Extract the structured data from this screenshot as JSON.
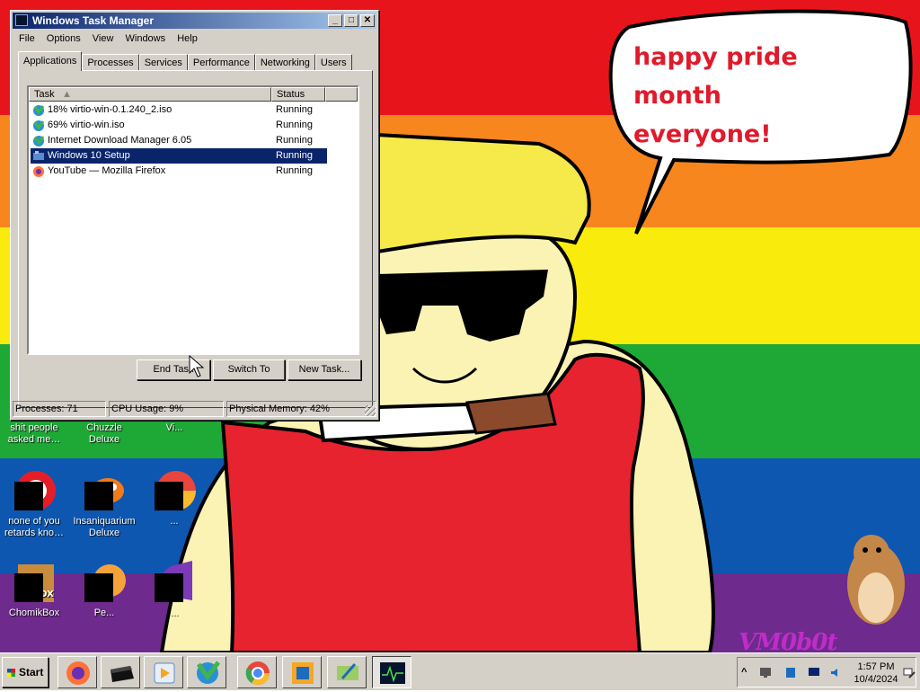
{
  "wallpaper": {
    "speech_bubble": [
      "happy pride month",
      "everyone!"
    ],
    "watermark": "VM0b0t"
  },
  "desktop_icons": [
    {
      "label": "shit people asked me…",
      "icon": "document-icon"
    },
    {
      "label": "Chuzzle Deluxe",
      "icon": "chuzzle-icon"
    },
    {
      "label": "Vi...",
      "icon": "shortcut-icon"
    },
    {
      "label": "none of you retards kno…",
      "icon": "opera-icon"
    },
    {
      "label": "Insaniquarium Deluxe",
      "icon": "insaniquarium-icon"
    },
    {
      "label": "...",
      "icon": "chrome-icon"
    },
    {
      "label": "ChomikBox",
      "icon": "chomikbox-icon"
    },
    {
      "label": "Pe...",
      "icon": "peggle-icon"
    },
    {
      "label": "...",
      "icon": "visual-studio-icon"
    }
  ],
  "task_manager": {
    "title": "Windows Task Manager",
    "window_buttons": [
      "_",
      "□",
      "✕"
    ],
    "menu": [
      "File",
      "Options",
      "View",
      "Windows",
      "Help"
    ],
    "tabs": [
      "Applications",
      "Processes",
      "Services",
      "Performance",
      "Networking",
      "Users"
    ],
    "active_tab": "Applications",
    "columns": [
      "Task",
      "Status"
    ],
    "rows": [
      {
        "task": "18% virtio-win-0.1.240_2.iso",
        "status": "Running",
        "icon": "idm-download-icon"
      },
      {
        "task": "69% virtio-win.iso",
        "status": "Running",
        "icon": "idm-download-icon"
      },
      {
        "task": "Internet Download Manager 6.05",
        "status": "Running",
        "icon": "idm-icon"
      },
      {
        "task": "Windows 10 Setup",
        "status": "Running",
        "icon": "setup-icon",
        "selected": true
      },
      {
        "task": "YouTube — Mozilla Firefox",
        "status": "Running",
        "icon": "firefox-icon"
      }
    ],
    "buttons": {
      "end_task": "End Task",
      "switch_to": "Switch To",
      "new_task": "New Task..."
    },
    "status": {
      "processes": "Processes: 71",
      "cpu": "CPU Usage: 9%",
      "memory": "Physical Memory: 42%"
    }
  },
  "taskbar": {
    "start_label": "Start",
    "apps": [
      "firefox-icon",
      "game-console-icon",
      "media-player-icon",
      "idm-icon",
      "chrome-icon",
      "virtualbox-icon",
      "network-paint-icon",
      "task-manager-icon"
    ],
    "clock_time": "1:57 PM",
    "clock_date": "10/4/2024",
    "tray": [
      "chevron-up-icon",
      "display-icon",
      "bluetooth-icon",
      "monitor-icon",
      "volume-icon",
      "network-icon"
    ]
  }
}
